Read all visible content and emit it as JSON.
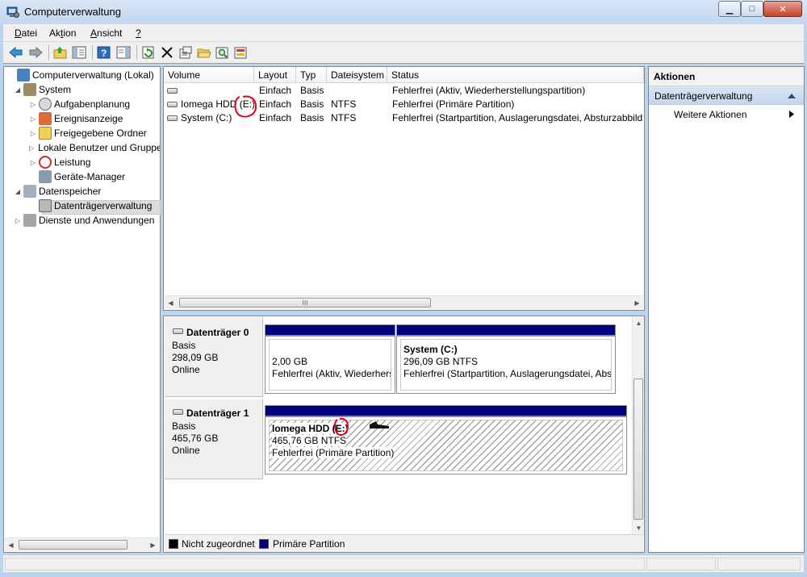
{
  "window": {
    "title": "Computerverwaltung",
    "minimize_glyph": "▁",
    "maximize_glyph": "□",
    "close_glyph": "✕"
  },
  "menu": [
    {
      "pre": "",
      "u": "D",
      "post": "atei"
    },
    {
      "pre": "Ak",
      "u": "t",
      "post": "ion"
    },
    {
      "pre": "",
      "u": "A",
      "post": "nsicht"
    },
    {
      "pre": "",
      "u": "?",
      "post": ""
    }
  ],
  "toolbar": {
    "icons": [
      "back-icon",
      "forward-icon",
      "up-folder-icon",
      "show-hide-tree-icon",
      "help-icon",
      "show-hide-action-pane-icon",
      "refresh-icon",
      "delete-icon",
      "properties-icon",
      "open-folder-icon",
      "search-icon",
      "export-icon"
    ]
  },
  "tree": {
    "items": [
      {
        "label": "Computerverwaltung (Lokal)",
        "icon": "computer-management-icon",
        "arrow": ""
      },
      {
        "label": "System",
        "icon": "system-tools-icon",
        "arrow": "◢"
      },
      {
        "label": "Aufgabenplanung",
        "icon": "task-scheduler-icon",
        "arrow": "▷"
      },
      {
        "label": "Ereignisanzeige",
        "icon": "event-viewer-icon",
        "arrow": "▷"
      },
      {
        "label": "Freigegebene Ordner",
        "icon": "shared-folders-icon",
        "arrow": "▷"
      },
      {
        "label": "Lokale Benutzer und Gruppen",
        "icon": "local-users-icon",
        "arrow": "▷"
      },
      {
        "label": "Leistung",
        "icon": "performance-icon",
        "arrow": "▷"
      },
      {
        "label": "Geräte-Manager",
        "icon": "device-manager-icon",
        "arrow": ""
      },
      {
        "label": "Datenspeicher",
        "icon": "storage-icon",
        "arrow": "◢"
      },
      {
        "label": "Datenträgerverwaltung",
        "icon": "disk-management-icon",
        "arrow": ""
      },
      {
        "label": "Dienste und Anwendungen",
        "icon": "services-icon",
        "arrow": "▷"
      }
    ]
  },
  "volumes": {
    "columns": [
      "Volume",
      "Layout",
      "Typ",
      "Dateisystem",
      "Status"
    ],
    "rows": [
      {
        "volume": "",
        "layout": "Einfach",
        "typ": "Basis",
        "fs": "",
        "status": "Fehlerfrei (Aktiv, Wiederherstellungspartition)"
      },
      {
        "volume": "Iomega HDD (E:)",
        "layout": "Einfach",
        "typ": "Basis",
        "fs": "NTFS",
        "status": "Fehlerfrei (Primäre Partition)"
      },
      {
        "volume": "System (C:)",
        "layout": "Einfach",
        "typ": "Basis",
        "fs": "NTFS",
        "status": "Fehlerfrei (Startpartition, Auslagerungsdatei, Absturzabbild, Primäre Partition)"
      }
    ],
    "scroll_grip": "III"
  },
  "disks": [
    {
      "name": "Datenträger 0",
      "type": "Basis",
      "size": "298,09 GB",
      "state": "Online",
      "partitions": [
        {
          "title": "",
          "size": "2,00 GB",
          "status": "Fehlerfrei (Aktiv, Wiederherstellungspartition)"
        },
        {
          "title": "System  (C:)",
          "size": "296,09 GB NTFS",
          "status": "Fehlerfrei (Startpartition, Auslagerungsdatei, Absturzabbild, Primäre Partition)"
        }
      ]
    },
    {
      "name": "Datenträger 1",
      "type": "Basis",
      "size": "465,76 GB",
      "state": "Online",
      "partitions": [
        {
          "title": "Iomega HDD  (E:)",
          "size": "465,76 GB NTFS",
          "status": "Fehlerfrei (Primäre Partition)"
        }
      ]
    }
  ],
  "legend": [
    {
      "label": "Nicht zugeordnet",
      "color": "#000000"
    },
    {
      "label": "Primäre Partition",
      "color": "#00007f"
    }
  ],
  "actions": {
    "header": "Aktionen",
    "section": "Datenträgerverwaltung",
    "item": "Weitere Aktionen"
  },
  "annotations": {
    "circle_color": "#e0001a"
  }
}
